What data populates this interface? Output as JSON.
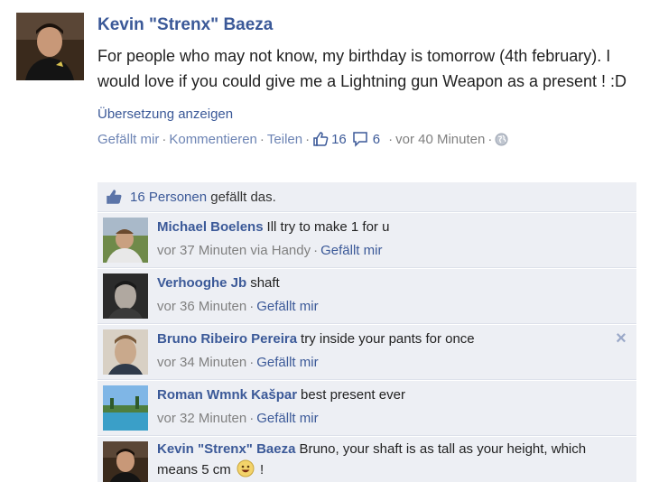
{
  "post": {
    "author": "Kevin \"Strenx\" Baeza",
    "text": "For people who may not know, my birthday is tomorrow (4th february). I would love if you could give me a Lightning gun Weapon as a present ! :D",
    "translate": "Übersetzung anzeigen",
    "actions": {
      "like": "Gefällt mir",
      "comment": "Kommentieren",
      "share": "Teilen",
      "like_count": "16",
      "comment_count": "6",
      "time": "vor 40 Minuten",
      "globe_icon": "globe-icon",
      "thumb_icon": "thumbs-up-icon",
      "comment_icon": "comment-bubble-icon"
    }
  },
  "likes": {
    "people": "16 Personen",
    "suffix": " gefällt das."
  },
  "comments": [
    {
      "author": "Michael Boelens",
      "text": "Ill try to make 1 for u",
      "time": "vor 37 Minuten via Handy",
      "like": "Gefällt mir"
    },
    {
      "author": "Verhooghe Jb",
      "text": "shaft",
      "time": "vor 36 Minuten",
      "like": "Gefällt mir"
    },
    {
      "author": "Bruno Ribeiro Pereira",
      "text": "try inside your pants for once",
      "time": "vor 34 Minuten",
      "like": "Gefällt mir"
    },
    {
      "author": "Roman Wmnk Kašpar",
      "text": "best present ever",
      "time": "vor 32 Minuten",
      "like": "Gefällt mir"
    },
    {
      "author": "Kevin \"Strenx\" Baeza",
      "text": "Bruno, your shaft is as tall as your height, which means 5 cm",
      "text_end": "!"
    }
  ],
  "colors": {
    "link": "#3b5998",
    "comment_bg": "#edeff4",
    "meta": "#808080"
  }
}
